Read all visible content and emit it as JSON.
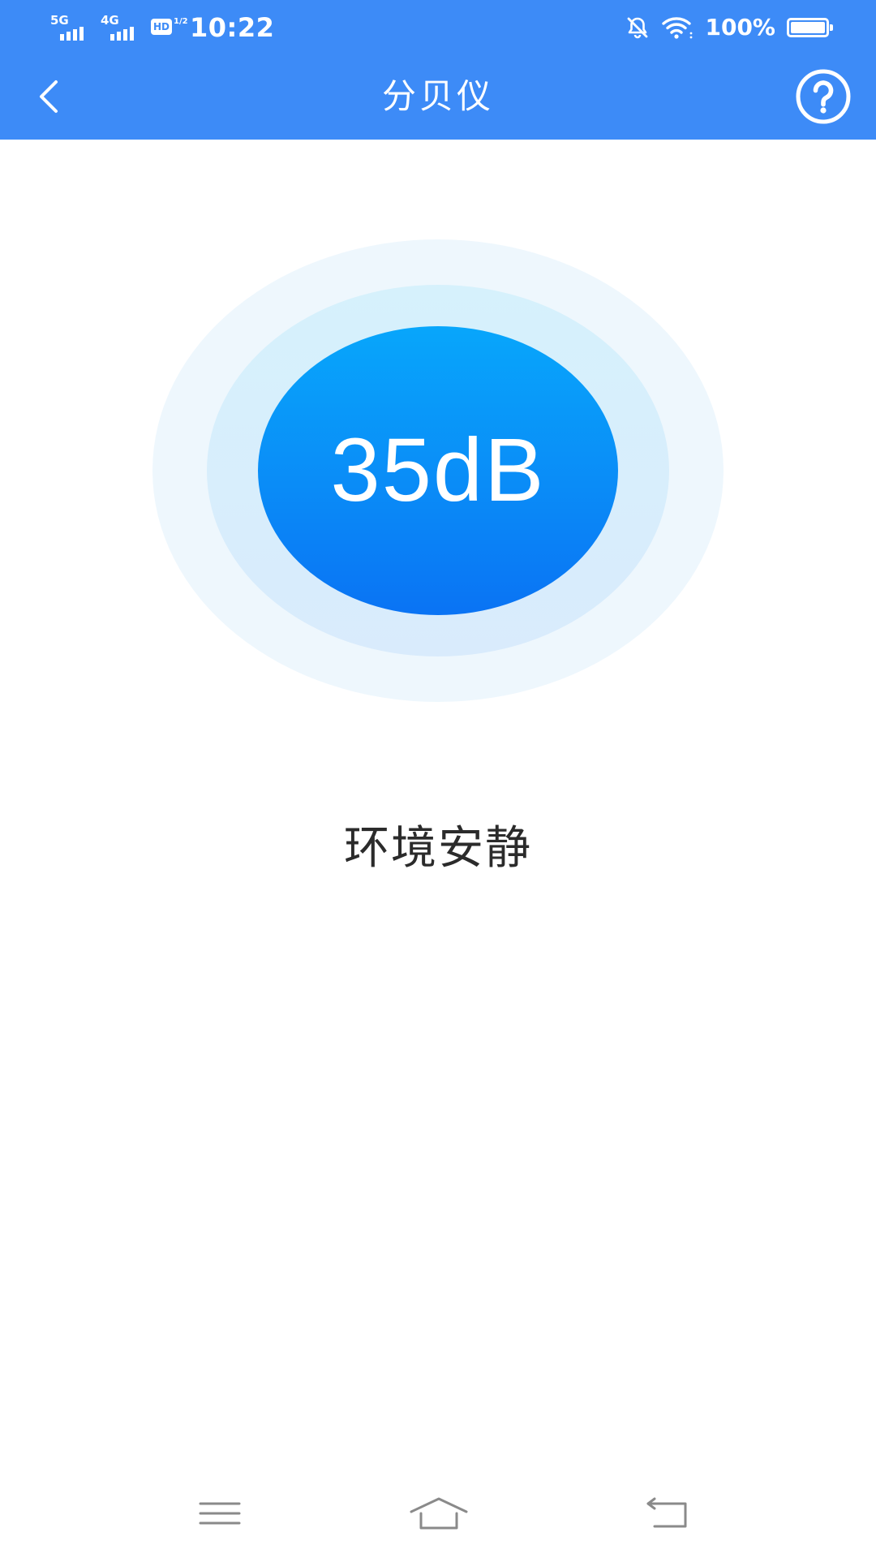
{
  "status_bar": {
    "net1": "5G",
    "net2": "4G",
    "hd_label": "HD",
    "hd_fraction": "1/2",
    "time": "10:22",
    "battery_percent": "100%",
    "battery_level": 1.0,
    "icons": {
      "mute": "bell-off-icon",
      "wifi": "wifi-icon",
      "battery": "battery-icon"
    }
  },
  "header": {
    "title": "分贝仪",
    "back_icon": "chevron-left-icon",
    "help_icon": "help-circle-icon"
  },
  "meter": {
    "reading": "35dB",
    "status": "环境安静"
  },
  "nav_bar": {
    "icons": [
      "menu-icon",
      "home-icon",
      "back-icon"
    ]
  },
  "colors": {
    "header_bg": "#3d8bf7",
    "meter_core_top": "#08a6fb",
    "meter_core_bottom": "#0a73f4",
    "ring_outer": "#eef7fd",
    "ring_mid": "#d6f1fc",
    "text_dark": "#2b2b2b",
    "nav_icon": "#8a8a8a"
  }
}
